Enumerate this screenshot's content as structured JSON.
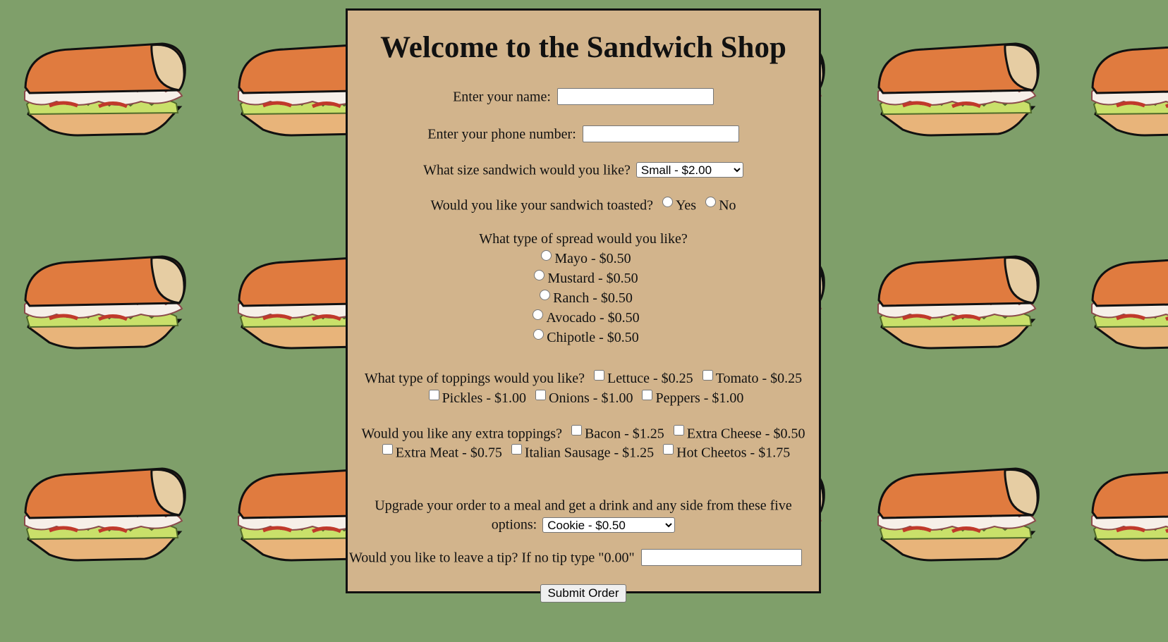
{
  "page": {
    "title": "Welcome to the Sandwich Shop"
  },
  "form": {
    "name_label": "Enter your name:",
    "name_value": "",
    "phone_label": "Enter your phone number:",
    "phone_value": "",
    "size_label": "What size sandwich would you like?",
    "size_selected": "Small - $2.00",
    "toast_label": "Would you like your sandwich toasted?",
    "toast_yes": "Yes",
    "toast_no": "No",
    "spread_label": "What type of spread would you like?",
    "spreads": [
      "Mayo - $0.50",
      "Mustard - $0.50",
      "Ranch - $0.50",
      "Avocado - $0.50",
      "Chipotle - $0.50"
    ],
    "toppings_label": "What type of toppings would you like?",
    "toppings": [
      "Lettuce - $0.25",
      "Tomato - $0.25",
      "Pickles - $1.00",
      "Onions - $1.00",
      "Peppers - $1.00"
    ],
    "extras_label": "Would you like any extra toppings?",
    "extras": [
      "Bacon - $1.25",
      "Extra Cheese - $0.50",
      "Extra Meat - $0.75",
      "Italian Sausage - $1.25",
      "Hot Cheetos - $1.75"
    ],
    "meal_label": "Upgrade your order to a meal and get a drink and any side from these five options:",
    "meal_selected": "Cookie - $0.50",
    "tip_label": "Would you like to leave a tip? If no tip type \"0.00\"",
    "tip_value": "",
    "submit_label": "Submit Order"
  },
  "colors": {
    "background": "#7f9f6a",
    "panel": "#d2b48c",
    "bread": "#e07b3f"
  },
  "background_image": "sandwich-pattern"
}
